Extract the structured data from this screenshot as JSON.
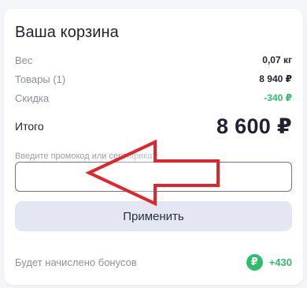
{
  "cart": {
    "title": "Ваша корзина",
    "weight": {
      "label": "Вес",
      "value": "0,07 кг"
    },
    "items": {
      "label": "Товары (1)",
      "value": "8 940 ₽"
    },
    "discount": {
      "label": "Скидка",
      "value": "-340 ₽"
    },
    "total": {
      "label": "Итого",
      "value": "8 600 ₽"
    }
  },
  "promo": {
    "placeholder": "Введите промокод или сертификат",
    "value": "",
    "apply_label": "Применить"
  },
  "bonus": {
    "label": "Будет начислено бонусов",
    "icon_glyph": "₽",
    "value": "+430"
  },
  "colors": {
    "accent_green": "#2ebd6b",
    "annotation_arrow": "#e0262b"
  }
}
